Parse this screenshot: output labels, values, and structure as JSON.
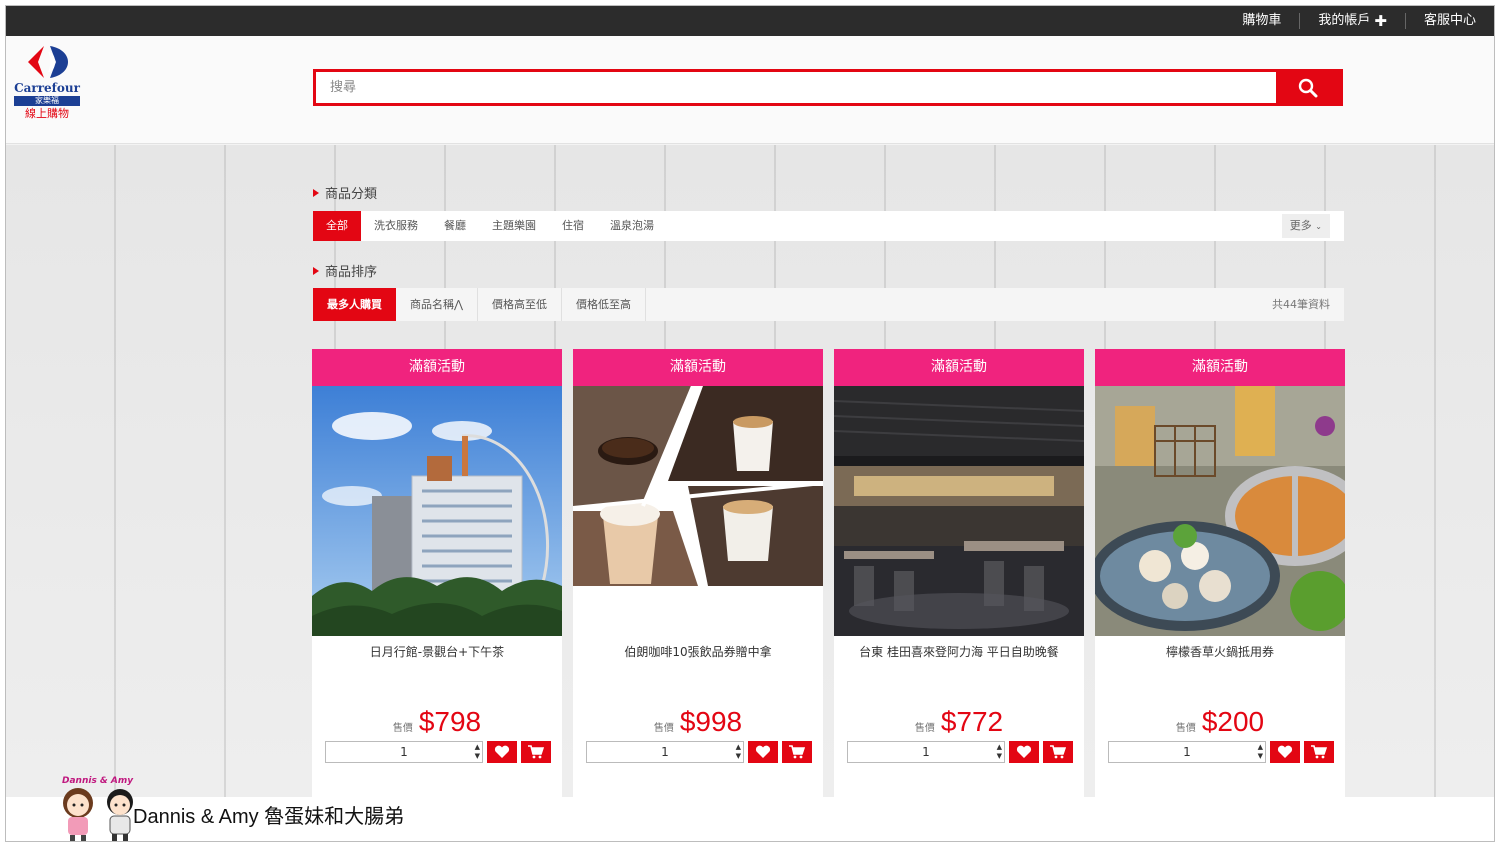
{
  "topbar": {
    "links": [
      "購物車",
      "我的帳戶",
      "客服中心"
    ]
  },
  "logo": {
    "name": "Carrefour",
    "sub_blue": "家樂福",
    "sub_red": "線上購物"
  },
  "search": {
    "placeholder": "搜尋"
  },
  "categories": {
    "title": "商品分類",
    "tabs": [
      "全部",
      "洗衣服務",
      "餐廳",
      "主題樂園",
      "住宿",
      "溫泉泡湯"
    ],
    "more": "更多"
  },
  "sorting": {
    "title": "商品排序",
    "tabs": [
      "最多人購買",
      "商品名稱⋀",
      "價格高至低",
      "價格低至高"
    ],
    "count": "共44筆資料"
  },
  "products": [
    {
      "banner": "滿額活動",
      "title": "日月行館-景觀台+下午茶",
      "price_label": "售價",
      "price": "$798",
      "qty": "1",
      "image": "hotel-building"
    },
    {
      "banner": "滿額活動",
      "title": "伯朗咖啡10張飲品券贈中拿",
      "price_label": "售價",
      "price": "$998",
      "qty": "1",
      "image": "coffee-collage"
    },
    {
      "banner": "滿額活動",
      "title": "台東 桂田喜來登阿力海 平日自助晚餐",
      "price_label": "售價",
      "price": "$772",
      "qty": "1",
      "image": "restaurant-interior"
    },
    {
      "banner": "滿額活動",
      "title": "檸檬香草火鍋抵用券",
      "price_label": "售價",
      "price": "$200",
      "qty": "1",
      "image": "hotpot"
    }
  ],
  "watermark": {
    "title": "Dannis & Amy",
    "text": "Dannis & Amy 魯蛋妹和大腸弟"
  }
}
